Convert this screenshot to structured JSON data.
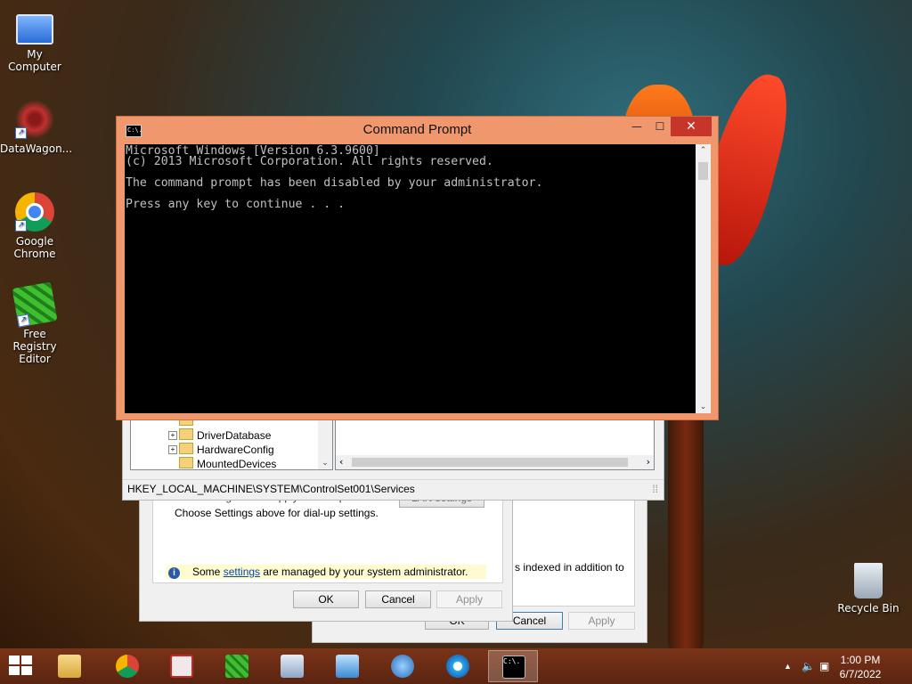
{
  "desktop": {
    "icons": [
      {
        "label": "My Computer",
        "icon": "computer-icon"
      },
      {
        "label": "DataWagon...",
        "icon": "datawagon-icon"
      },
      {
        "label": "Google Chrome",
        "icon": "chrome-icon"
      },
      {
        "label": "Free Registry Editor",
        "icon": "registry-editor-icon"
      },
      {
        "label": "Recycle Bin",
        "icon": "recycle-bin-icon"
      }
    ]
  },
  "cmd": {
    "title": "Command Prompt",
    "icon_text": "C:\\.",
    "lines": [
      "Microsoft Windows [Version 6.3.9600]",
      "(c) 2013 Microsoft Corporation. All rights reserved.",
      "",
      "The command prompt has been disabled by your administrator.",
      "",
      "Press any key to continue . . ."
    ],
    "controls": {
      "minimize": "—",
      "maximize": "☐",
      "close": "✕"
    }
  },
  "regedit": {
    "tree": [
      "DriverDatabase",
      "HardwareConfig",
      "MountedDevices"
    ],
    "status_path": "HKEY_LOCAL_MACHINE\\SYSTEM\\ControlSet001\\Services"
  },
  "internet_options": {
    "partial_text": "LAN Settings do not apply to dial-up connections.",
    "partial_button": "LAN settings",
    "text_line": "Choose Settings above for dial-up settings.",
    "info_prefix": "Some ",
    "info_link": "settings",
    "info_suffix": " are managed by your system administrator.",
    "ok": "OK",
    "cancel": "Cancel",
    "apply": "Apply"
  },
  "indexing": {
    "partial_text": "s indexed in addition to",
    "ok": "OK",
    "cancel": "Cancel",
    "apply": "Apply"
  },
  "taskbar": {
    "time": "1:00 PM",
    "date": "6/7/2022",
    "apps": [
      "file-explorer-icon",
      "chrome-icon",
      "datawagon-icon",
      "registry-editor-icon",
      "performance-monitor-icon",
      "control-panel-icon",
      "network-setup-icon",
      "internet-explorer-icon",
      "command-prompt-icon"
    ],
    "active_app": "command-prompt-icon"
  }
}
